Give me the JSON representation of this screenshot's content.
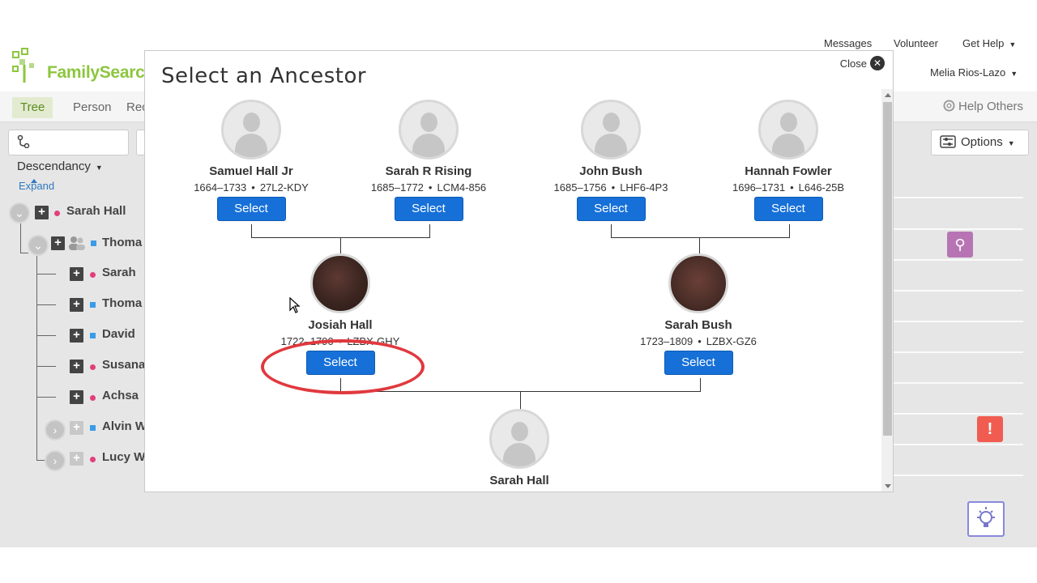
{
  "header": {
    "logo_text": "FamilySearch",
    "links": [
      "Messages",
      "Volunteer",
      "Get Help"
    ],
    "user": "Melia Rios-Lazo"
  },
  "nav": {
    "tabs": [
      "Tree",
      "Person",
      "Rec"
    ],
    "help_others": "Help Others"
  },
  "toolbar": {
    "view_label": "Descendancy",
    "options_label": "Options"
  },
  "tree": {
    "expand_label": "Expand",
    "rows": [
      {
        "name": "Sarah Hall",
        "gender": "f"
      },
      {
        "name": "Thoma",
        "gender": "m"
      },
      {
        "name": "Sarah",
        "gender": "f"
      },
      {
        "name": "Thoma",
        "gender": "m"
      },
      {
        "name": "David",
        "gender": "m"
      },
      {
        "name": "Susana",
        "gender": "f"
      },
      {
        "name": "Achsa",
        "gender": "f"
      },
      {
        "name": "Alvin W",
        "gender": "m"
      },
      {
        "name": "Lucy W",
        "gender": "f"
      }
    ]
  },
  "modal": {
    "title": "Select an Ancestor",
    "close_label": "Close",
    "select_label": "Select",
    "people": {
      "gp1": {
        "name": "Samuel Hall Jr",
        "dates": "1664–1733",
        "id": "27L2-KDY"
      },
      "gp2": {
        "name": "Sarah R Rising",
        "dates": "1685–1772",
        "id": "LCM4-856"
      },
      "gp3": {
        "name": "John Bush",
        "dates": "1685–1756",
        "id": "LHF6-4P3"
      },
      "gp4": {
        "name": "Hannah Fowler",
        "dates": "1696–1731",
        "id": "L646-25B"
      },
      "p1": {
        "name": "Josiah Hall",
        "dates": "1722–1790",
        "id": "LZBX-GHY"
      },
      "p2": {
        "name": "Sarah Bush",
        "dates": "1723–1809",
        "id": "LZBX-GZ6"
      },
      "child": {
        "name": "Sarah Hall"
      }
    }
  },
  "colors": {
    "brand_green": "#8dc63f",
    "select_blue": "#1670d8",
    "highlight_red": "#e0393e"
  }
}
